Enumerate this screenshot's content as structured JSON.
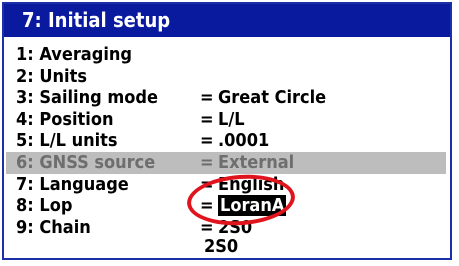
{
  "window": {
    "title": "7: Initial setup"
  },
  "menu": {
    "items": [
      {
        "label": "1: Averaging",
        "value": ""
      },
      {
        "label": "2: Units",
        "value": ""
      },
      {
        "label": "3: Sailing mode",
        "eq": "=",
        "value": "Great Circle"
      },
      {
        "label": "4: Position",
        "eq": "=",
        "value": "L/L"
      },
      {
        "label": "5: L/L units",
        "eq": "=",
        "value": ".0001"
      },
      {
        "label": "6: GNSS source",
        "eq": "=",
        "value": "External",
        "disabled": true
      },
      {
        "label": "7: Language",
        "eq": "=",
        "value": "English"
      },
      {
        "label": "8: Lop",
        "eq": "=",
        "value": "LoranA",
        "selected": true
      },
      {
        "label": "9: Chain",
        "eq": "=",
        "value": "2S0"
      }
    ],
    "dropdown_options": [
      "2S0",
      "2S0"
    ]
  },
  "colors": {
    "title_bar": "#0a1a9e",
    "disabled_row": "#bdbdbd",
    "annotation": "#e0141c"
  }
}
